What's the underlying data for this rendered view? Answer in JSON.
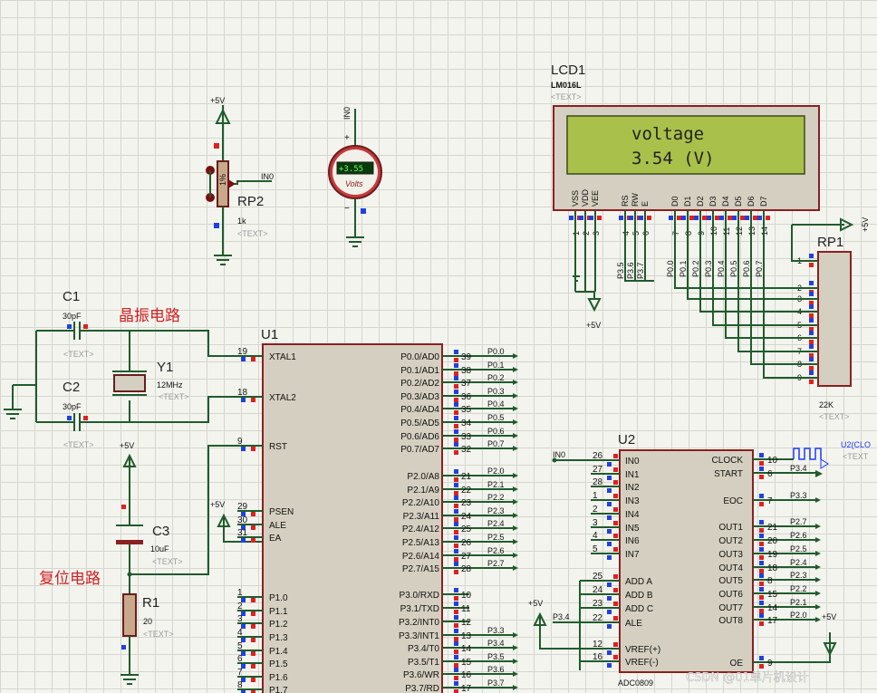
{
  "labels": {
    "lcd_name": "LCD1",
    "lcd_part": "LM016L",
    "lcd_text_tag": "<TEXT>",
    "lcd_line1": "voltage",
    "lcd_line2": "3.54 (V)",
    "lcd_pins": [
      "VSS",
      "VDD",
      "VEE",
      "RS",
      "RW",
      "E",
      "D0",
      "D1",
      "D2",
      "D3",
      "D4",
      "D5",
      "D6",
      "D7"
    ],
    "lcd_pin_nums": [
      "1",
      "2",
      "3",
      "4",
      "5",
      "6",
      "7",
      "8",
      "9",
      "10",
      "11",
      "12",
      "13",
      "14"
    ],
    "lcd_ctrl_nets": [
      "P3.5",
      "P3.6",
      "P3.7"
    ],
    "lcd_data_nets": [
      "P0.0",
      "P0.1",
      "P0.2",
      "P0.3",
      "P0.4",
      "P0.5",
      "P0.6",
      "P0.7"
    ],
    "rp1_name": "RP1",
    "rp1_value": "22K",
    "rp1_tag": "<TEXT>",
    "rp1_pins": [
      "1",
      "2",
      "3",
      "4",
      "5",
      "6",
      "7",
      "8",
      "9"
    ],
    "plus5v": "+5V",
    "rp2_name": "RP2",
    "rp2_value": "1k",
    "rp2_tag": "<TEXT>",
    "in0": "IN0",
    "voltmeter_reading": "+3.55",
    "voltmeter_unit": "Volts",
    "c1_name": "C1",
    "c1_value": "30pF",
    "c1_tag": "<TEXT>",
    "c2_name": "C2",
    "c2_value": "30pF",
    "c2_tag": "<TEXT>",
    "y1_name": "Y1",
    "y1_value": "12MHz",
    "y1_tag": "<TEXT>",
    "c3_name": "C3",
    "c3_value": "10uF",
    "c3_tag": "<TEXT>",
    "r1_name": "R1",
    "r1_value": "20",
    "r1_tag": "<TEXT>",
    "crystal_label": "晶振电路",
    "reset_label": "复位电路",
    "u1_name": "U1",
    "u1_left_pins": [
      {
        "num": "19",
        "name": "XTAL1"
      },
      {
        "num": "18",
        "name": "XTAL2"
      },
      {
        "num": "9",
        "name": "RST"
      },
      {
        "num": "29",
        "name": "PSEN"
      },
      {
        "num": "30",
        "name": "ALE"
      },
      {
        "num": "31",
        "name": "EA"
      },
      {
        "num": "1",
        "name": "P1.0"
      },
      {
        "num": "2",
        "name": "P1.1"
      },
      {
        "num": "3",
        "name": "P1.2"
      },
      {
        "num": "4",
        "name": "P1.3"
      },
      {
        "num": "5",
        "name": "P1.4"
      },
      {
        "num": "6",
        "name": "P1.5"
      },
      {
        "num": "7",
        "name": "P1.6"
      },
      {
        "num": "8",
        "name": "P1.7"
      }
    ],
    "u1_right_pins": [
      {
        "num": "39",
        "name": "P0.0/AD0",
        "net": "P0.0"
      },
      {
        "num": "38",
        "name": "P0.1/AD1",
        "net": "P0.1"
      },
      {
        "num": "37",
        "name": "P0.2/AD2",
        "net": "P0.2"
      },
      {
        "num": "36",
        "name": "P0.3/AD3",
        "net": "P0.3"
      },
      {
        "num": "35",
        "name": "P0.4/AD4",
        "net": "P0.4"
      },
      {
        "num": "34",
        "name": "P0.5/AD5",
        "net": "P0.5"
      },
      {
        "num": "33",
        "name": "P0.6/AD6",
        "net": "P0.6"
      },
      {
        "num": "32",
        "name": "P0.7/AD7",
        "net": "P0.7"
      },
      {
        "num": "21",
        "name": "P2.0/A8",
        "net": "P2.0"
      },
      {
        "num": "22",
        "name": "P2.1/A9",
        "net": "P2.1"
      },
      {
        "num": "23",
        "name": "P2.2/A10",
        "net": "P2.2"
      },
      {
        "num": "24",
        "name": "P2.3/A11",
        "net": "P2.3"
      },
      {
        "num": "25",
        "name": "P2.4/A12",
        "net": "P2.4"
      },
      {
        "num": "26",
        "name": "P2.5/A13",
        "net": "P2.5"
      },
      {
        "num": "27",
        "name": "P2.6/A14",
        "net": "P2.6"
      },
      {
        "num": "28",
        "name": "P2.7/A15",
        "net": "P2.7"
      },
      {
        "num": "10",
        "name": "P3.0/RXD",
        "net": ""
      },
      {
        "num": "11",
        "name": "P3.1/TXD",
        "net": ""
      },
      {
        "num": "12",
        "name": "P3.2/INT0",
        "net": ""
      },
      {
        "num": "13",
        "name": "P3.3/INT1",
        "net": "P3.3"
      },
      {
        "num": "14",
        "name": "P3.4/T0",
        "net": "P3.4"
      },
      {
        "num": "15",
        "name": "P3.5/T1",
        "net": "P3.5"
      },
      {
        "num": "16",
        "name": "P3.6/WR",
        "net": "P3.6"
      },
      {
        "num": "17",
        "name": "P3.7/RD",
        "net": "P3.7"
      }
    ],
    "u2_name": "U2",
    "u2_part": "ADC0809",
    "u2_left_pins": [
      {
        "num": "26",
        "name": "IN0"
      },
      {
        "num": "27",
        "name": "IN1"
      },
      {
        "num": "28",
        "name": "IN2"
      },
      {
        "num": "1",
        "name": "IN3"
      },
      {
        "num": "2",
        "name": "IN4"
      },
      {
        "num": "3",
        "name": "IN5"
      },
      {
        "num": "4",
        "name": "IN6"
      },
      {
        "num": "5",
        "name": "IN7"
      },
      {
        "num": "25",
        "name": "ADD A"
      },
      {
        "num": "24",
        "name": "ADD B"
      },
      {
        "num": "23",
        "name": "ADD C"
      },
      {
        "num": "22",
        "name": "ALE"
      },
      {
        "num": "12",
        "name": "VREF(+)"
      },
      {
        "num": "16",
        "name": "VREF(-)"
      }
    ],
    "u2_right_pins": [
      {
        "num": "10",
        "name": "CLOCK",
        "net": ""
      },
      {
        "num": "6",
        "name": "START",
        "net": "P3.4"
      },
      {
        "num": "7",
        "name": "EOC",
        "net": "P3.3"
      },
      {
        "num": "21",
        "name": "OUT1",
        "net": "P2.7"
      },
      {
        "num": "20",
        "name": "OUT2",
        "net": "P2.6"
      },
      {
        "num": "19",
        "name": "OUT3",
        "net": "P2.5"
      },
      {
        "num": "18",
        "name": "OUT4",
        "net": "P2.4"
      },
      {
        "num": "8",
        "name": "OUT5",
        "net": "P2.3"
      },
      {
        "num": "15",
        "name": "OUT6",
        "net": "P2.2"
      },
      {
        "num": "14",
        "name": "OUT7",
        "net": "P2.1"
      },
      {
        "num": "17",
        "name": "OUT8",
        "net": "P2.0"
      },
      {
        "num": "9",
        "name": "OE",
        "net": ""
      }
    ],
    "u2_ale_net": "P3.4",
    "clock_gen_label": "U2(CLO",
    "clock_gen_tag": "<TEXT",
    "watermark": "CSDN @01单片机设计"
  }
}
